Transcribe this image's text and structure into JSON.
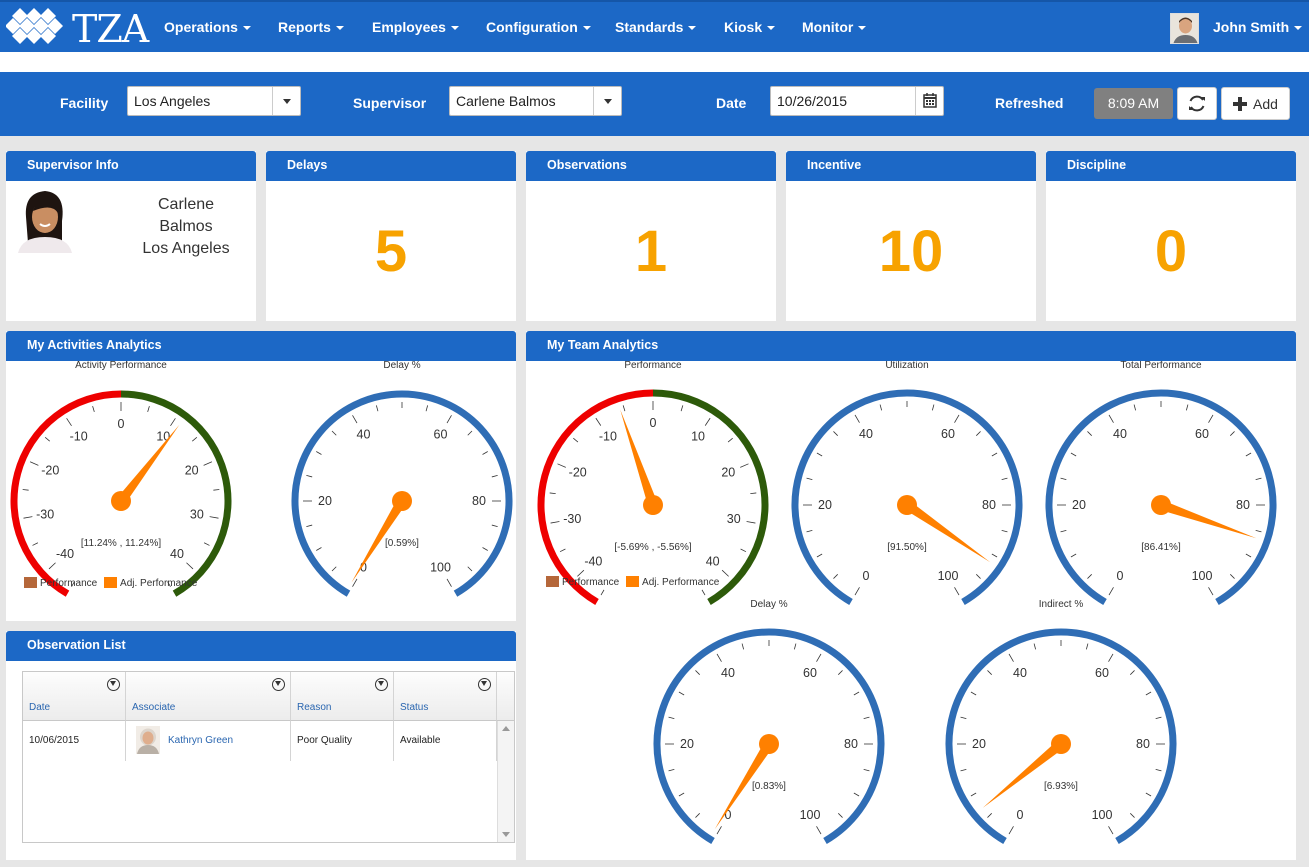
{
  "app": {
    "brand": "TZA"
  },
  "nav": {
    "items": [
      "Operations",
      "Reports",
      "Employees",
      "Configuration",
      "Standards",
      "Kiosk",
      "Monitor"
    ],
    "user_name": "John Smith"
  },
  "filters": {
    "facility_label": "Facility",
    "facility_value": "Los Angeles",
    "supervisor_label": "Supervisor",
    "supervisor_value": "Carlene Balmos",
    "date_label": "Date",
    "date_value": "10/26/2015",
    "refreshed_label": "Refreshed",
    "refreshed_time": "8:09 AM",
    "add_label": "Add"
  },
  "cards": {
    "supervisor_info": {
      "title": "Supervisor Info",
      "first_name": "Carlene",
      "last_name": "Balmos",
      "location": "Los Angeles"
    },
    "delays": {
      "title": "Delays",
      "value": "5"
    },
    "observations": {
      "title": "Observations",
      "value": "1"
    },
    "incentive": {
      "title": "Incentive",
      "value": "10"
    },
    "discipline": {
      "title": "Discipline",
      "value": "0"
    }
  },
  "colors": {
    "primary": "#1c68c6",
    "accent": "#f7a200",
    "needle": "#ff8000",
    "gauge_blue": "#2f6db5",
    "gauge_red": "#ee0000",
    "gauge_green": "#2d5a0a",
    "legend_performance": "#b5673a"
  },
  "my_activities": {
    "title": "My Activities Analytics",
    "legend": [
      "Performance",
      "Adj. Performance"
    ]
  },
  "my_team": {
    "title": "My Team Analytics",
    "legend": [
      "Performance",
      "Adj. Performance"
    ]
  },
  "observation_list": {
    "title": "Observation List",
    "columns": [
      "Date",
      "Associate",
      "Reason",
      "Status"
    ],
    "rows": [
      {
        "date": "10/06/2015",
        "associate": "Kathryn Green",
        "reason": "Poor Quality",
        "status": "Available"
      }
    ]
  },
  "chart_data": [
    {
      "type": "gauge",
      "title": "Activity Performance",
      "scale": "performance",
      "range": [
        -45,
        45
      ],
      "ticks": [
        -40,
        -30,
        -20,
        -10,
        0,
        10,
        20,
        30,
        40
      ],
      "bands": [
        {
          "from": -45,
          "to": 0,
          "color": "red"
        },
        {
          "from": 0,
          "to": 45,
          "color": "green"
        }
      ],
      "value": 11.24,
      "readout": "[11.24% , 11.24%]"
    },
    {
      "type": "gauge",
      "title": "Delay %",
      "scale": "percent",
      "range": [
        0,
        100
      ],
      "ticks": [
        0,
        20,
        40,
        60,
        80,
        100
      ],
      "value": 0.59,
      "readout": "[0.59%]"
    },
    {
      "type": "gauge",
      "title": "Performance",
      "scale": "performance",
      "range": [
        -45,
        45
      ],
      "ticks": [
        -40,
        -30,
        -20,
        -10,
        0,
        10,
        20,
        30,
        40
      ],
      "bands": [
        {
          "from": -45,
          "to": 0,
          "color": "red"
        },
        {
          "from": 0,
          "to": 45,
          "color": "green"
        }
      ],
      "value": -5.69,
      "readout": "[-5.69% , -5.56%]"
    },
    {
      "type": "gauge",
      "title": "Utilization",
      "scale": "percent",
      "range": [
        0,
        100
      ],
      "ticks": [
        0,
        20,
        40,
        60,
        80,
        100
      ],
      "value": 91.5,
      "readout": "[91.50%]"
    },
    {
      "type": "gauge",
      "title": "Total Performance",
      "scale": "percent",
      "range": [
        0,
        100
      ],
      "ticks": [
        0,
        20,
        40,
        60,
        80,
        100
      ],
      "value": 86.41,
      "readout": "[86.41%]"
    },
    {
      "type": "gauge",
      "title": "Delay %",
      "scale": "percent",
      "range": [
        0,
        100
      ],
      "ticks": [
        0,
        20,
        40,
        60,
        80,
        100
      ],
      "value": 0.83,
      "readout": "[0.83%]"
    },
    {
      "type": "gauge",
      "title": "Indirect %",
      "scale": "percent",
      "range": [
        0,
        100
      ],
      "ticks": [
        0,
        20,
        40,
        60,
        80,
        100
      ],
      "value": 6.93,
      "readout": "[6.93%]"
    }
  ]
}
